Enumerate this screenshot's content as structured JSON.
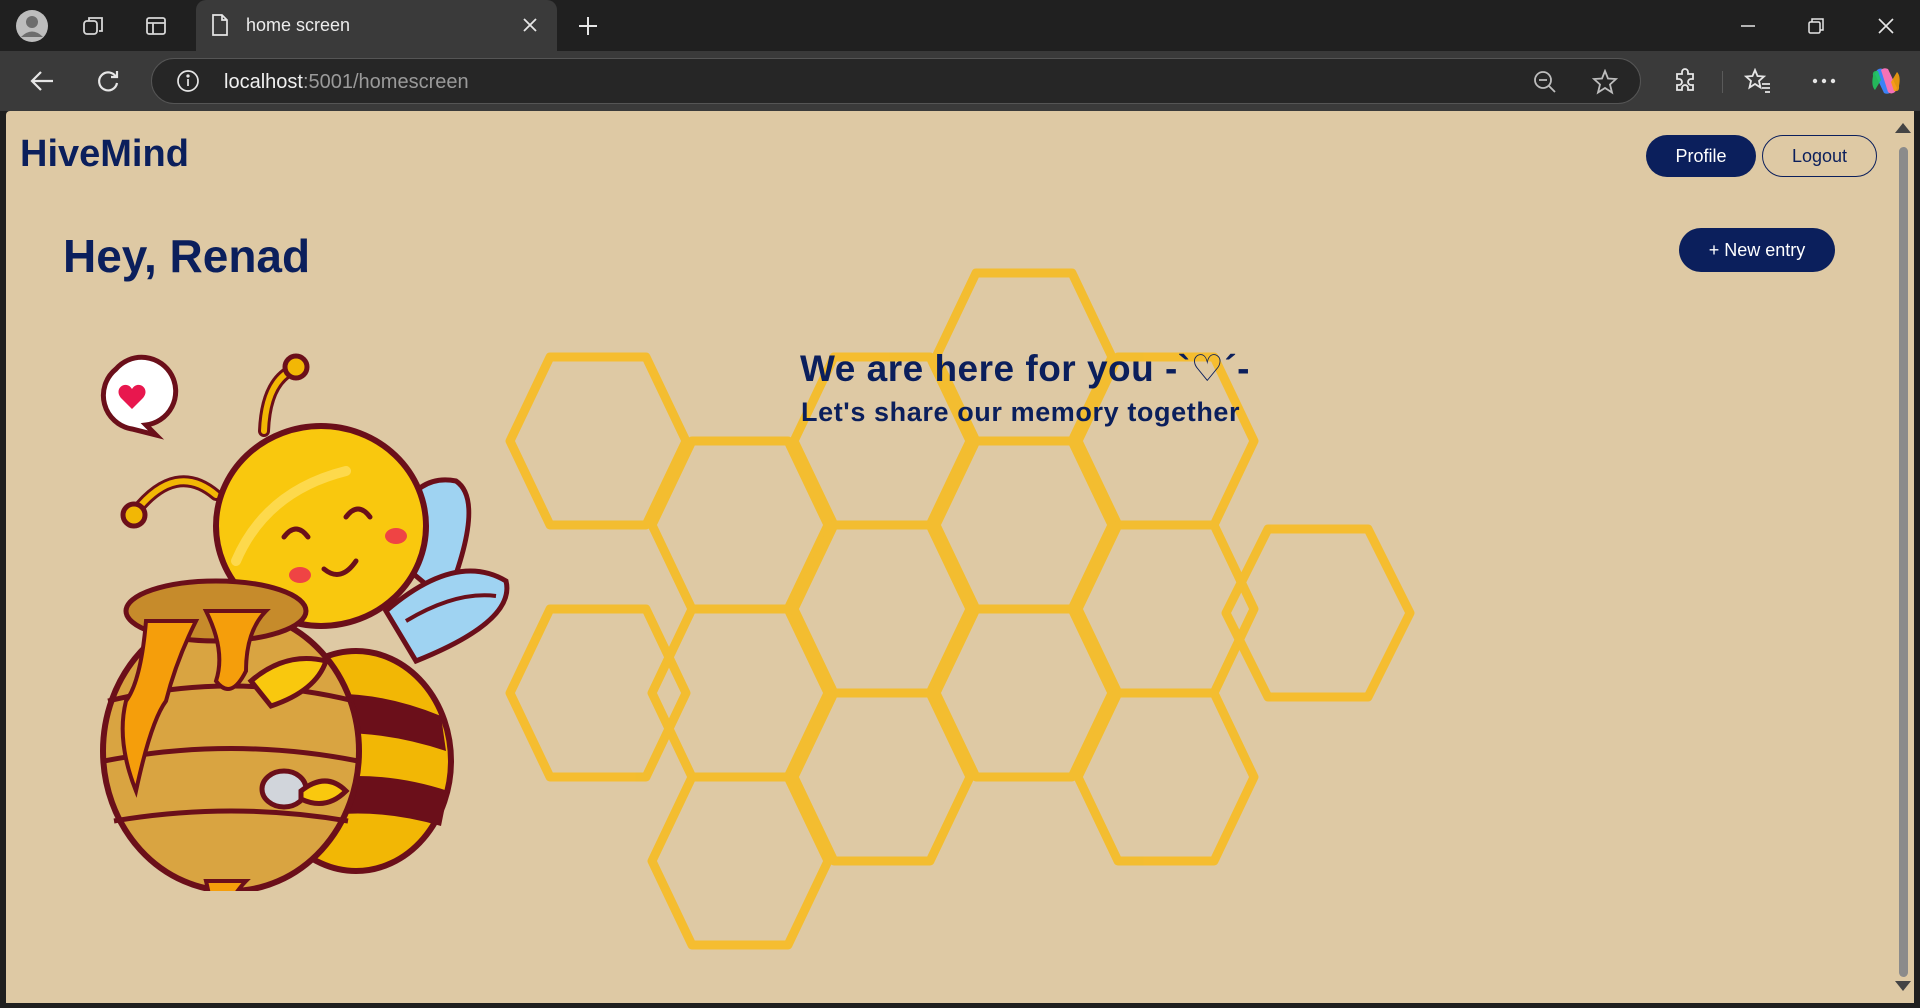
{
  "browser": {
    "tab_title": "home screen",
    "url_host": "localhost",
    "url_path": ":5001/homescreen"
  },
  "header": {
    "brand": "HiveMind",
    "profile_label": "Profile",
    "logout_label": "Logout"
  },
  "main": {
    "greeting": "Hey, Renad",
    "new_entry_label": "+ New entry",
    "tagline": "We are here for you -`♡´-",
    "subtagline": "Let's share our memory together"
  },
  "colors": {
    "page_bg": "#dec9a4",
    "brand_navy": "#0b1f5c",
    "honeycomb": "#f5bd2a"
  }
}
